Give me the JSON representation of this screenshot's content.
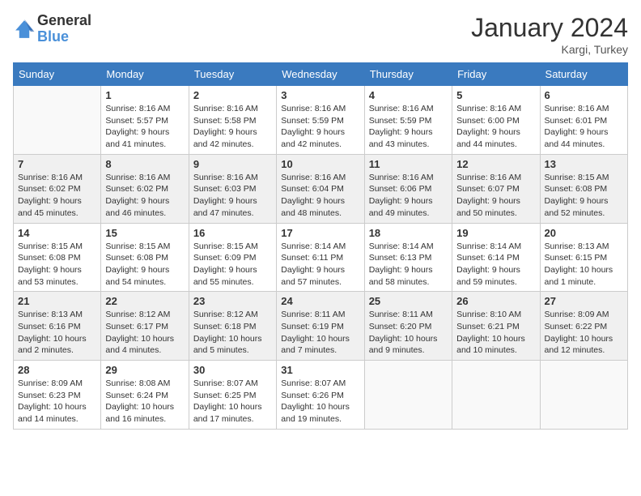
{
  "logo": {
    "general": "General",
    "blue": "Blue"
  },
  "title": "January 2024",
  "location": "Kargi, Turkey",
  "weekdays": [
    "Sunday",
    "Monday",
    "Tuesday",
    "Wednesday",
    "Thursday",
    "Friday",
    "Saturday"
  ],
  "weeks": [
    [
      {
        "day": "",
        "info": ""
      },
      {
        "day": "1",
        "info": "Sunrise: 8:16 AM\nSunset: 5:57 PM\nDaylight: 9 hours\nand 41 minutes."
      },
      {
        "day": "2",
        "info": "Sunrise: 8:16 AM\nSunset: 5:58 PM\nDaylight: 9 hours\nand 42 minutes."
      },
      {
        "day": "3",
        "info": "Sunrise: 8:16 AM\nSunset: 5:59 PM\nDaylight: 9 hours\nand 42 minutes."
      },
      {
        "day": "4",
        "info": "Sunrise: 8:16 AM\nSunset: 5:59 PM\nDaylight: 9 hours\nand 43 minutes."
      },
      {
        "day": "5",
        "info": "Sunrise: 8:16 AM\nSunset: 6:00 PM\nDaylight: 9 hours\nand 44 minutes."
      },
      {
        "day": "6",
        "info": "Sunrise: 8:16 AM\nSunset: 6:01 PM\nDaylight: 9 hours\nand 44 minutes."
      }
    ],
    [
      {
        "day": "7",
        "info": ""
      },
      {
        "day": "8",
        "info": "Sunrise: 8:16 AM\nSunset: 6:02 PM\nDaylight: 9 hours\nand 46 minutes."
      },
      {
        "day": "9",
        "info": "Sunrise: 8:16 AM\nSunset: 6:03 PM\nDaylight: 9 hours\nand 47 minutes."
      },
      {
        "day": "10",
        "info": "Sunrise: 8:16 AM\nSunset: 6:04 PM\nDaylight: 9 hours\nand 48 minutes."
      },
      {
        "day": "11",
        "info": "Sunrise: 8:16 AM\nSunset: 6:06 PM\nDaylight: 9 hours\nand 49 minutes."
      },
      {
        "day": "12",
        "info": "Sunrise: 8:16 AM\nSunset: 6:07 PM\nDaylight: 9 hours\nand 50 minutes."
      },
      {
        "day": "13",
        "info": "Sunrise: 8:15 AM\nSunset: 6:08 PM\nDaylight: 9 hours\nand 52 minutes."
      }
    ],
    [
      {
        "day": "14",
        "info": ""
      },
      {
        "day": "15",
        "info": "Sunrise: 8:15 AM\nSunset: 6:08 PM\nDaylight: 9 hours\nand 54 minutes."
      },
      {
        "day": "16",
        "info": "Sunrise: 8:15 AM\nSunset: 6:09 PM\nDaylight: 9 hours\nand 55 minutes."
      },
      {
        "day": "17",
        "info": "Sunrise: 8:14 AM\nSunset: 6:11 PM\nDaylight: 9 hours\nand 57 minutes."
      },
      {
        "day": "18",
        "info": "Sunrise: 8:14 AM\nSunset: 6:13 PM\nDaylight: 9 hours\nand 58 minutes."
      },
      {
        "day": "19",
        "info": "Sunrise: 8:14 AM\nSunset: 6:14 PM\nDaylight: 9 hours\nand 59 minutes."
      },
      {
        "day": "20",
        "info": "Sunrise: 8:13 AM\nSunset: 6:15 PM\nDaylight: 10 hours\nand 1 minute."
      }
    ],
    [
      {
        "day": "21",
        "info": ""
      },
      {
        "day": "22",
        "info": "Sunrise: 8:12 AM\nSunset: 6:17 PM\nDaylight: 10 hours\nand 4 minutes."
      },
      {
        "day": "23",
        "info": "Sunrise: 8:12 AM\nSunset: 6:18 PM\nDaylight: 10 hours\nand 5 minutes."
      },
      {
        "day": "24",
        "info": "Sunrise: 8:11 AM\nSunset: 6:19 PM\nDaylight: 10 hours\nand 7 minutes."
      },
      {
        "day": "25",
        "info": "Sunrise: 8:11 AM\nSunset: 6:20 PM\nDaylight: 10 hours\nand 9 minutes."
      },
      {
        "day": "26",
        "info": "Sunrise: 8:10 AM\nSunset: 6:21 PM\nDaylight: 10 hours\nand 10 minutes."
      },
      {
        "day": "27",
        "info": "Sunrise: 8:09 AM\nSunset: 6:22 PM\nDaylight: 10 hours\nand 12 minutes."
      }
    ],
    [
      {
        "day": "28",
        "info": ""
      },
      {
        "day": "29",
        "info": "Sunrise: 8:08 AM\nSunset: 6:24 PM\nDaylight: 10 hours\nand 16 minutes."
      },
      {
        "day": "30",
        "info": "Sunrise: 8:07 AM\nSunset: 6:25 PM\nDaylight: 10 hours\nand 17 minutes."
      },
      {
        "day": "31",
        "info": "Sunrise: 8:07 AM\nSunset: 6:26 PM\nDaylight: 10 hours\nand 19 minutes."
      },
      {
        "day": "",
        "info": ""
      },
      {
        "day": "",
        "info": ""
      },
      {
        "day": "",
        "info": ""
      }
    ]
  ],
  "week1_sun": {
    "day": "7",
    "info": "Sunrise: 8:16 AM\nSunset: 6:02 PM\nDaylight: 9 hours\nand 45 minutes."
  },
  "week2_sun": {
    "day": "14",
    "info": "Sunrise: 8:15 AM\nSunset: 6:08 PM\nDaylight: 9 hours\nand 53 minutes."
  },
  "week3_sun": {
    "day": "21",
    "info": "Sunrise: 8:13 AM\nSunset: 6:16 PM\nDaylight: 10 hours\nand 2 minutes."
  },
  "week4_sun": {
    "day": "28",
    "info": "Sunrise: 8:09 AM\nSunset: 6:23 PM\nDaylight: 10 hours\nand 14 minutes."
  }
}
